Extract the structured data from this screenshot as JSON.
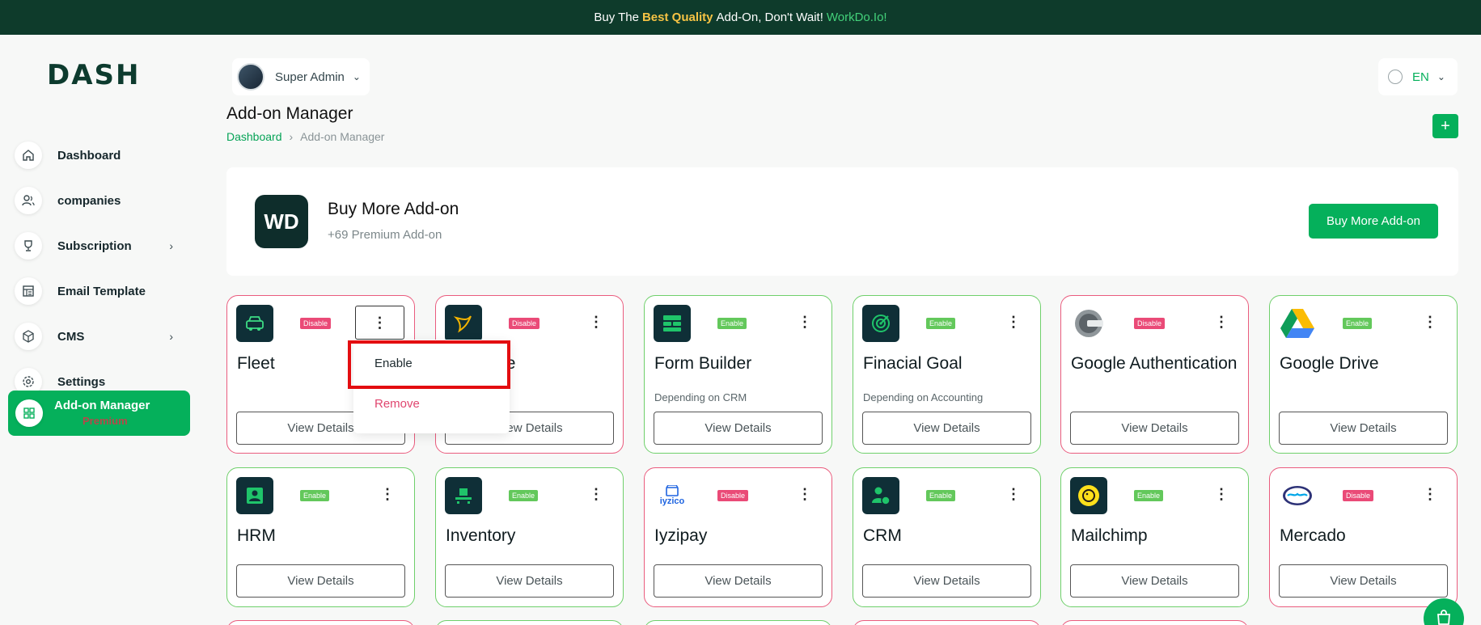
{
  "announcement": {
    "prefix": "Buy The",
    "highlight": "Best Quality",
    "middle": "Add-On, Don't Wait!",
    "link": "WorkDo.Io!"
  },
  "brand": {
    "logo_text": "DASH"
  },
  "sidebar": {
    "items": [
      {
        "label": "Dashboard",
        "icon": "home-icon"
      },
      {
        "label": "companies",
        "icon": "users-icon"
      },
      {
        "label": "Subscription",
        "icon": "trophy-icon",
        "chevron": true
      },
      {
        "label": "Email Template",
        "icon": "template-icon"
      },
      {
        "label": "CMS",
        "icon": "cube-icon",
        "chevron": true
      },
      {
        "label": "Settings",
        "icon": "gear-icon"
      }
    ],
    "active": {
      "label": "Add-on Manager",
      "sub": "Premium",
      "icon": "grid-icon"
    }
  },
  "header": {
    "user_name": "Super Admin",
    "language": "EN"
  },
  "page": {
    "title": "Add-on Manager",
    "breadcrumb_home": "Dashboard",
    "breadcrumb_current": "Add-on Manager"
  },
  "promo": {
    "logo": "WD",
    "title": "Buy More Add-on",
    "subtitle": "+69 Premium Add-on",
    "button": "Buy More Add-on"
  },
  "cards": [
    {
      "name": "Fleet",
      "status": "Disable",
      "dep": "",
      "view": "View Details"
    },
    {
      "name": "Paystave",
      "status": "Disable",
      "dep": "",
      "view": "View Details"
    },
    {
      "name": "Form Builder",
      "status": "Enable",
      "dep": "Depending on CRM",
      "view": "View Details"
    },
    {
      "name": "Finacial Goal",
      "status": "Enable",
      "dep": "Depending on Accounting",
      "view": "View Details"
    },
    {
      "name": "Google Authentication",
      "status": "Disable",
      "dep": "",
      "view": "View Details"
    },
    {
      "name": "Google Drive",
      "status": "Enable",
      "dep": "",
      "view": "View Details"
    },
    {
      "name": "HRM",
      "status": "Enable",
      "dep": "",
      "view": "View Details"
    },
    {
      "name": "Inventory",
      "status": "Enable",
      "dep": "",
      "view": "View Details"
    },
    {
      "name": "Iyzipay",
      "status": "Disable",
      "dep": "",
      "view": "View Details",
      "logo_text": "iyzico"
    },
    {
      "name": "CRM",
      "status": "Enable",
      "dep": "",
      "view": "View Details"
    },
    {
      "name": "Mailchimp",
      "status": "Enable",
      "dep": "",
      "view": "View Details"
    },
    {
      "name": "Mercado",
      "status": "Disable",
      "dep": "",
      "view": "View Details"
    }
  ],
  "dropdown": {
    "enable": "Enable",
    "remove": "Remove"
  },
  "colors": {
    "primary": "#05b05b",
    "dark": "#0e3b2b",
    "enable_border": "#6fd06b",
    "disable_border": "#ea5c7e",
    "highlight": "#e30d10"
  }
}
